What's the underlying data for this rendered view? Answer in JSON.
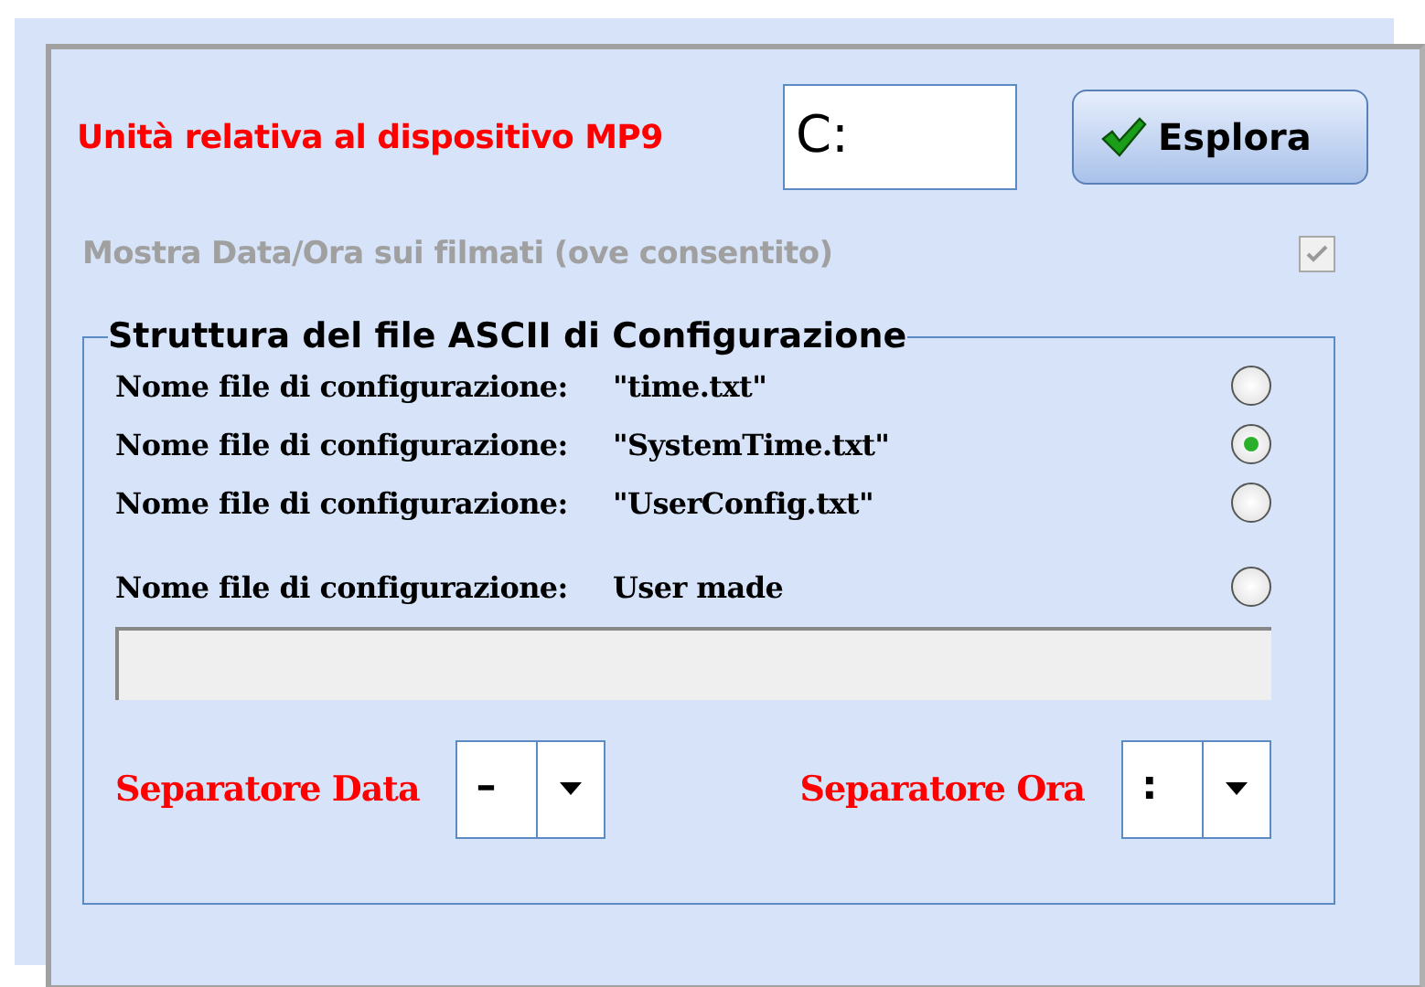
{
  "drive": {
    "label": "Unità relativa al dispositivo MP9",
    "value": "C:"
  },
  "browse_button": {
    "label": "Esplora"
  },
  "show_datetime": {
    "label": "Mostra Data/Ora sui filmati (ove consentito)",
    "checked": true,
    "disabled": true
  },
  "group": {
    "title": "Struttura del file ASCII di Configurazione",
    "options": [
      {
        "label": "Nome file di configurazione:",
        "value": "\"time.txt\"",
        "selected": false
      },
      {
        "label": "Nome file di configurazione:",
        "value": "\"SystemTime.txt\"",
        "selected": true
      },
      {
        "label": "Nome file di configurazione:",
        "value": "\"UserConfig.txt\"",
        "selected": false
      },
      {
        "label": "Nome file di configurazione:",
        "value": "User made",
        "selected": false
      }
    ],
    "custom_name": {
      "disabled": true
    },
    "separators": [
      {
        "label": "Separatore Data",
        "value": "–"
      },
      {
        "label": "Separatore Ora",
        "value": ":"
      }
    ]
  }
}
